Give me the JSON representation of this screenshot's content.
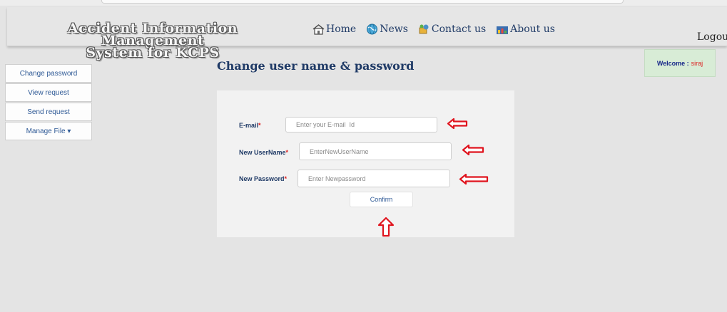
{
  "header": {
    "logo_line1": "Accident Information Management",
    "logo_line2": "System for KCPS",
    "nav": [
      {
        "label": "Home",
        "icon": "home-icon"
      },
      {
        "label": "News",
        "icon": "globe-icon"
      },
      {
        "label": "Contact us",
        "icon": "contact-icon"
      },
      {
        "label": "About us",
        "icon": "about-icon"
      }
    ],
    "logout_label": "Logou"
  },
  "welcome": {
    "prefix": "Welcome :",
    "user": "siraj"
  },
  "sidebar": {
    "items": [
      {
        "label": "Change password"
      },
      {
        "label": "View request"
      },
      {
        "label": "Send request"
      },
      {
        "label": "Manage File ▾"
      }
    ]
  },
  "main": {
    "title": "Change user name & password",
    "form": {
      "email": {
        "label": "E-mail",
        "required_mark": "*",
        "placeholder": "Enter your E-mail  Id",
        "value": ""
      },
      "username": {
        "label": "New UserName",
        "required_mark": "*",
        "placeholder": "EnterNewUserName",
        "value": ""
      },
      "password": {
        "label": "New Password",
        "required_mark": "*",
        "placeholder": "Enter Newpassword",
        "value": ""
      },
      "confirm_label": "Confirm"
    }
  },
  "annotations": {
    "arrow_color": "#e0141e"
  },
  "colors": {
    "background": "#e4e4e4",
    "panel": "#f2f2f2",
    "accent": "#1f3a66",
    "welcome_bg": "#d8ecd6"
  }
}
